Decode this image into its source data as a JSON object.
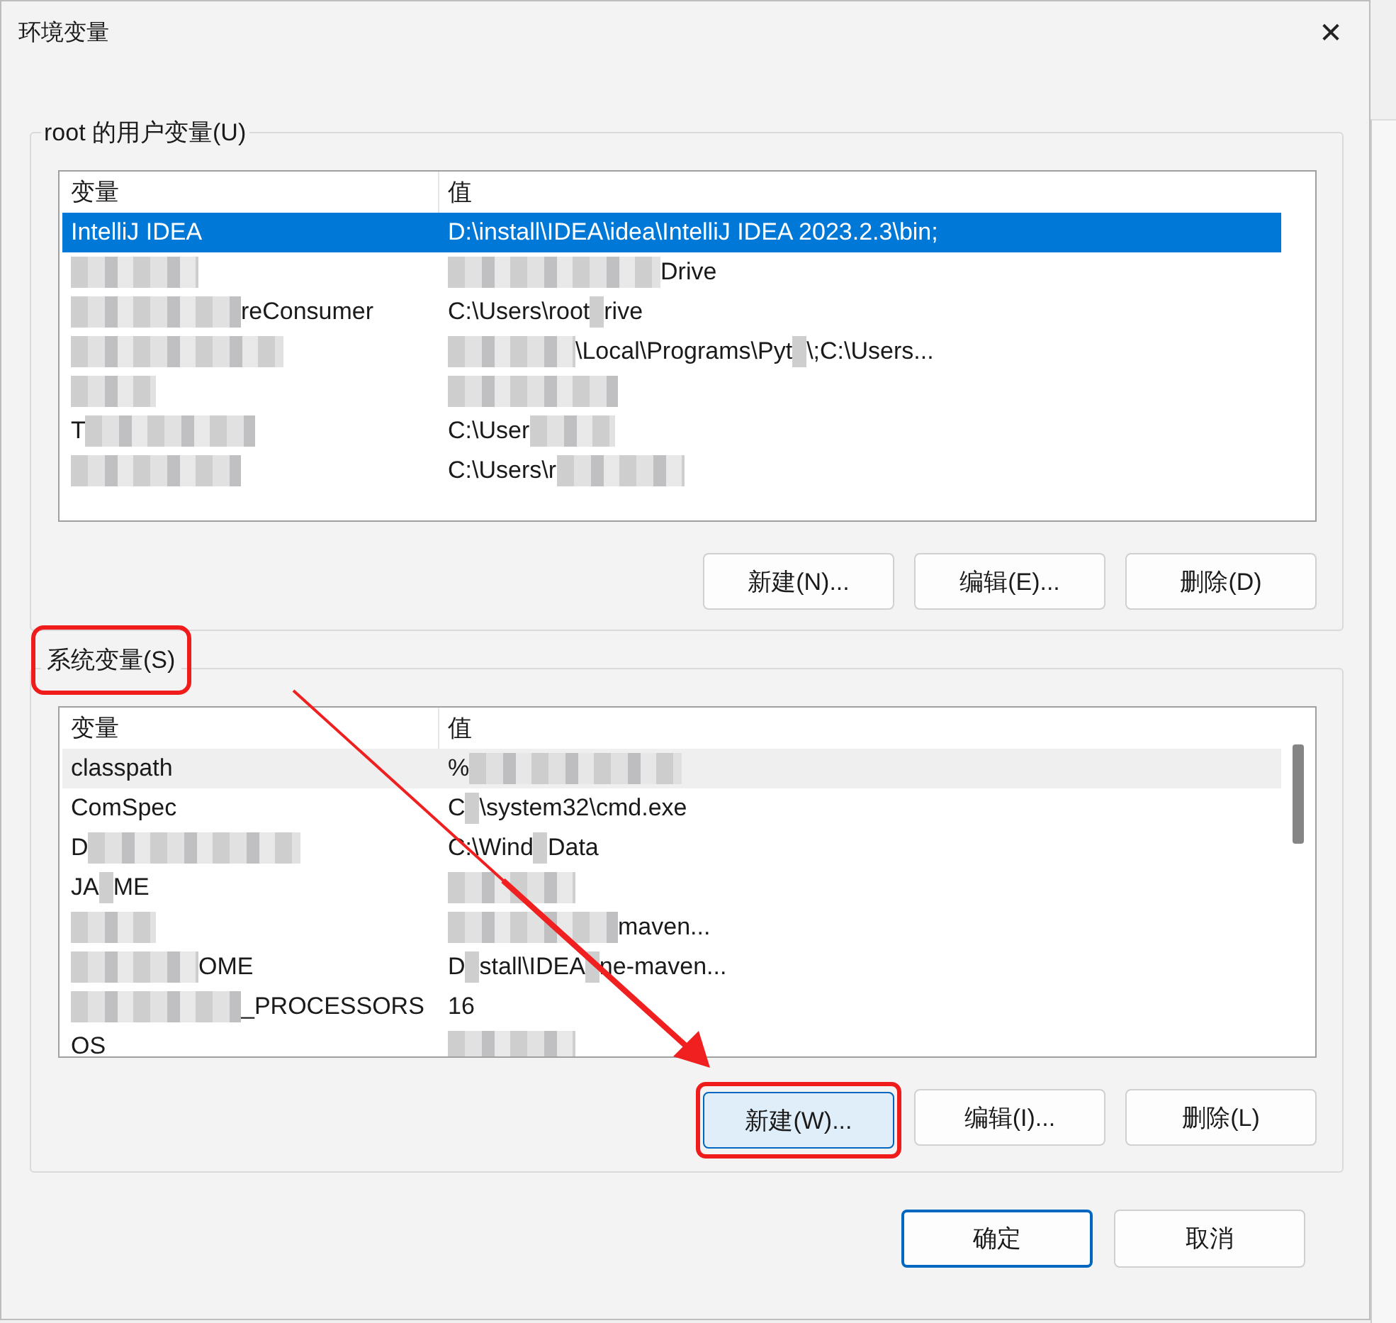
{
  "window": {
    "title": "环境变量",
    "close": "✕"
  },
  "groups": [
    {
      "label": "root 的用户变量(U)",
      "label_highlighted": false,
      "columns": [
        "变量",
        "值"
      ],
      "scrollbar": false,
      "rows": [
        {
          "selected": true,
          "highlighted": false,
          "name": [
            {
              "kind": "text",
              "text": "IntelliJ IDEA"
            }
          ],
          "value": [
            {
              "kind": "text",
              "text": "D:\\install\\IDEA\\idea\\IntelliJ IDEA 2023.2.3\\bin;"
            }
          ]
        },
        {
          "selected": false,
          "highlighted": false,
          "name": [
            {
              "kind": "blur"
            }
          ],
          "value": [
            {
              "kind": "blur"
            },
            {
              "kind": "text",
              "text": "Drive"
            }
          ]
        },
        {
          "selected": false,
          "highlighted": false,
          "name": [
            {
              "kind": "blur"
            },
            {
              "kind": "text",
              "text": "reConsumer"
            }
          ],
          "value": [
            {
              "kind": "text",
              "text": "C:\\Users\\root"
            },
            {
              "kind": "blur"
            },
            {
              "kind": "text",
              "text": "rive"
            }
          ]
        },
        {
          "selected": false,
          "highlighted": false,
          "name": [
            {
              "kind": "blur"
            }
          ],
          "value": [
            {
              "kind": "blur"
            },
            {
              "kind": "text",
              "text": "\\Local\\Programs\\Pyt"
            },
            {
              "kind": "blur"
            },
            {
              "kind": "text",
              "text": "\\;C:\\Users..."
            }
          ]
        },
        {
          "selected": false,
          "highlighted": false,
          "name": [
            {
              "kind": "blur"
            }
          ],
          "value": [
            {
              "kind": "blur"
            }
          ]
        },
        {
          "selected": false,
          "highlighted": false,
          "name": [
            {
              "kind": "text",
              "text": "T"
            },
            {
              "kind": "blur"
            }
          ],
          "value": [
            {
              "kind": "text",
              "text": "C:\\User"
            },
            {
              "kind": "blur"
            }
          ]
        },
        {
          "selected": false,
          "highlighted": false,
          "name": [
            {
              "kind": "blur"
            }
          ],
          "value": [
            {
              "kind": "text",
              "text": "C:\\Users\\r"
            },
            {
              "kind": "blur"
            }
          ]
        }
      ],
      "buttons": [
        {
          "label": "新建(N)...",
          "highlighted": false
        },
        {
          "label": "编辑(E)...",
          "highlighted": false
        },
        {
          "label": "删除(D)",
          "highlighted": false
        }
      ]
    },
    {
      "label": "系统变量(S)",
      "label_highlighted": true,
      "columns": [
        "变量",
        "值"
      ],
      "scrollbar": true,
      "rows": [
        {
          "selected": false,
          "highlighted": true,
          "name": [
            {
              "kind": "text",
              "text": "classpath"
            }
          ],
          "value": [
            {
              "kind": "text",
              "text": "%"
            },
            {
              "kind": "blur"
            }
          ]
        },
        {
          "selected": false,
          "highlighted": false,
          "name": [
            {
              "kind": "text",
              "text": "ComSpec"
            }
          ],
          "value": [
            {
              "kind": "text",
              "text": "C"
            },
            {
              "kind": "blur"
            },
            {
              "kind": "text",
              "text": "\\system32\\cmd.exe"
            }
          ]
        },
        {
          "selected": false,
          "highlighted": false,
          "name": [
            {
              "kind": "text",
              "text": "D"
            },
            {
              "kind": "blur"
            }
          ],
          "value": [
            {
              "kind": "text",
              "text": "C:\\Wind"
            },
            {
              "kind": "blur"
            },
            {
              "kind": "text",
              "text": "Data"
            }
          ]
        },
        {
          "selected": false,
          "highlighted": false,
          "name": [
            {
              "kind": "text",
              "text": "JA"
            },
            {
              "kind": "blur"
            },
            {
              "kind": "text",
              "text": "ME"
            }
          ],
          "value": [
            {
              "kind": "blur"
            }
          ]
        },
        {
          "selected": false,
          "highlighted": false,
          "name": [
            {
              "kind": "blur"
            }
          ],
          "value": [
            {
              "kind": "blur"
            },
            {
              "kind": "text",
              "text": "maven..."
            }
          ]
        },
        {
          "selected": false,
          "highlighted": false,
          "name": [
            {
              "kind": "blur"
            },
            {
              "kind": "text",
              "text": "OME"
            }
          ],
          "value": [
            {
              "kind": "text",
              "text": "D"
            },
            {
              "kind": "blur"
            },
            {
              "kind": "text",
              "text": "stall\\IDEA"
            },
            {
              "kind": "blur"
            },
            {
              "kind": "text",
              "text": "ne-maven..."
            }
          ]
        },
        {
          "selected": false,
          "highlighted": false,
          "name": [
            {
              "kind": "blur"
            },
            {
              "kind": "text",
              "text": "_PROCESSORS"
            }
          ],
          "value": [
            {
              "kind": "text",
              "text": "16"
            }
          ]
        },
        {
          "selected": false,
          "highlighted": false,
          "name": [
            {
              "kind": "text",
              "text": "OS"
            }
          ],
          "value": [
            {
              "kind": "blur"
            }
          ]
        }
      ],
      "buttons": [
        {
          "label": "新建(W)...",
          "highlighted": true
        },
        {
          "label": "编辑(I)...",
          "highlighted": false
        },
        {
          "label": "删除(L)",
          "highlighted": false
        }
      ]
    }
  ],
  "footer": [
    {
      "label": "确定",
      "default": true
    },
    {
      "label": "取消",
      "default": false
    }
  ],
  "arrow": true
}
